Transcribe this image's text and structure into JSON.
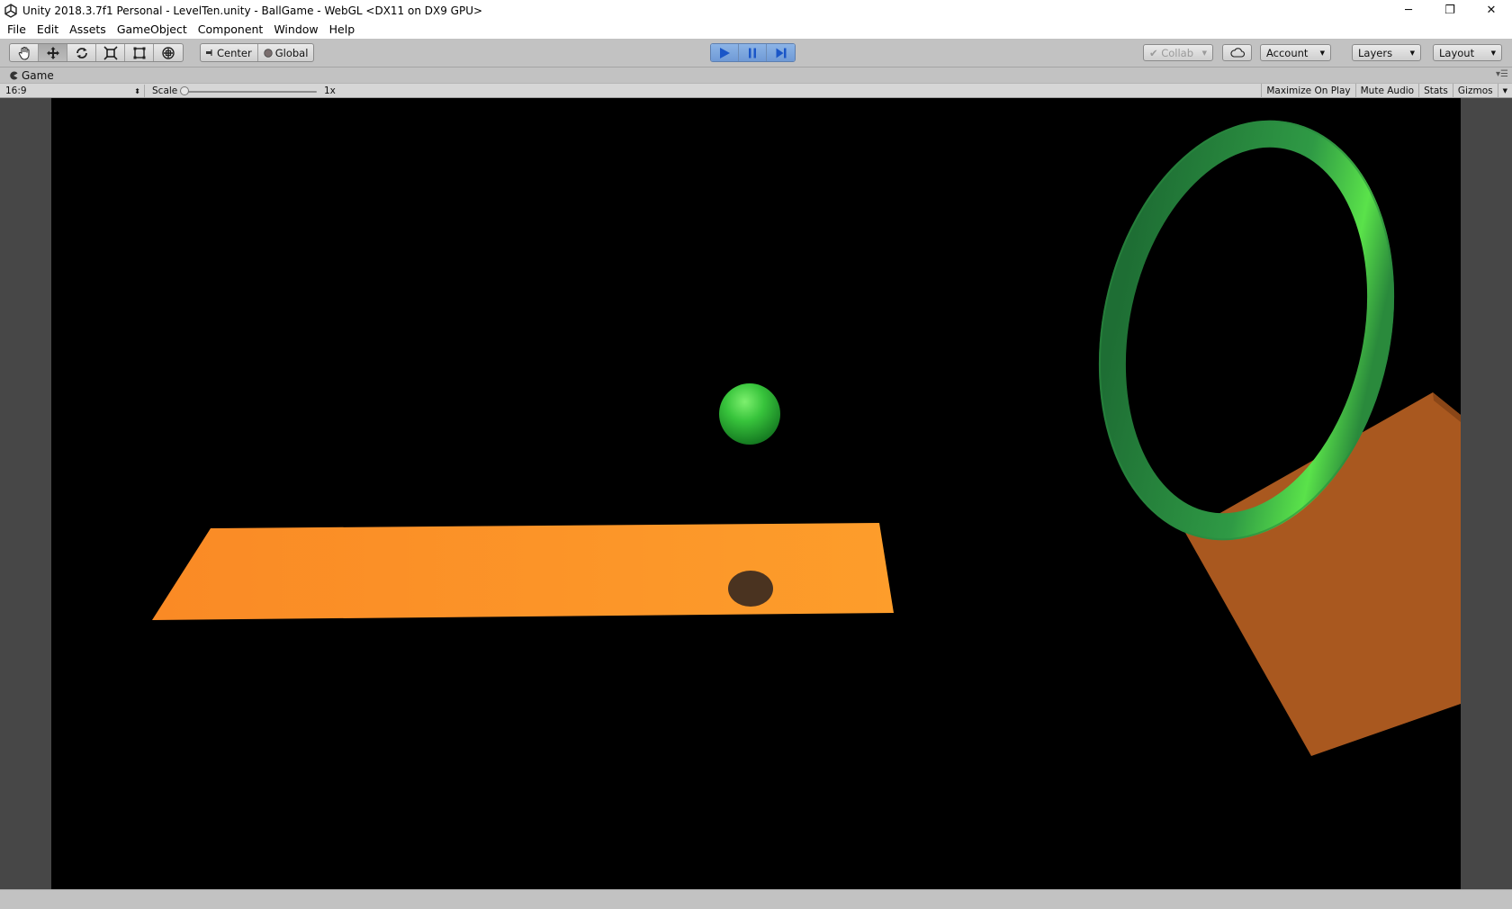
{
  "window": {
    "title": "Unity 2018.3.7f1 Personal - LevelTen.unity - BallGame - WebGL <DX11 on DX9 GPU>",
    "controls": {
      "minimize": "─",
      "restore": "❐",
      "close": "✕"
    }
  },
  "menu": {
    "items": [
      "File",
      "Edit",
      "Assets",
      "GameObject",
      "Component",
      "Window",
      "Help"
    ]
  },
  "toolbar": {
    "tools": [
      {
        "name": "hand-tool",
        "icon": "hand-icon"
      },
      {
        "name": "move-tool",
        "icon": "move-arrows-icon",
        "active": true
      },
      {
        "name": "rotate-tool",
        "icon": "rotate-icon"
      },
      {
        "name": "scale-tool",
        "icon": "scale-icon"
      },
      {
        "name": "rect-tool",
        "icon": "rect-icon"
      },
      {
        "name": "transform-tool",
        "icon": "transform-icon"
      }
    ],
    "pivot_label": "Center",
    "space_label": "Global",
    "playback": {
      "play": "play-icon",
      "pause": "pause-icon",
      "step": "step-icon",
      "playing": true
    },
    "collab_label": "Collab",
    "account_label": "Account",
    "layers_label": "Layers",
    "layout_label": "Layout"
  },
  "tab": {
    "label": "Game"
  },
  "gamebar": {
    "aspect": "16:9",
    "scale_label": "Scale",
    "scale_value": "1x",
    "maximize_label": "Maximize On Play",
    "mute_label": "Mute Audio",
    "stats_label": "Stats",
    "gizmos_label": "Gizmos"
  },
  "colors": {
    "viewport_bg": "#000000",
    "platform": "#f98c25",
    "box": "#a9581f",
    "ring": "#2f9a45",
    "ball": "#38c43c",
    "shadow": "#4a3320",
    "play_accent": "#6f9ad6"
  }
}
